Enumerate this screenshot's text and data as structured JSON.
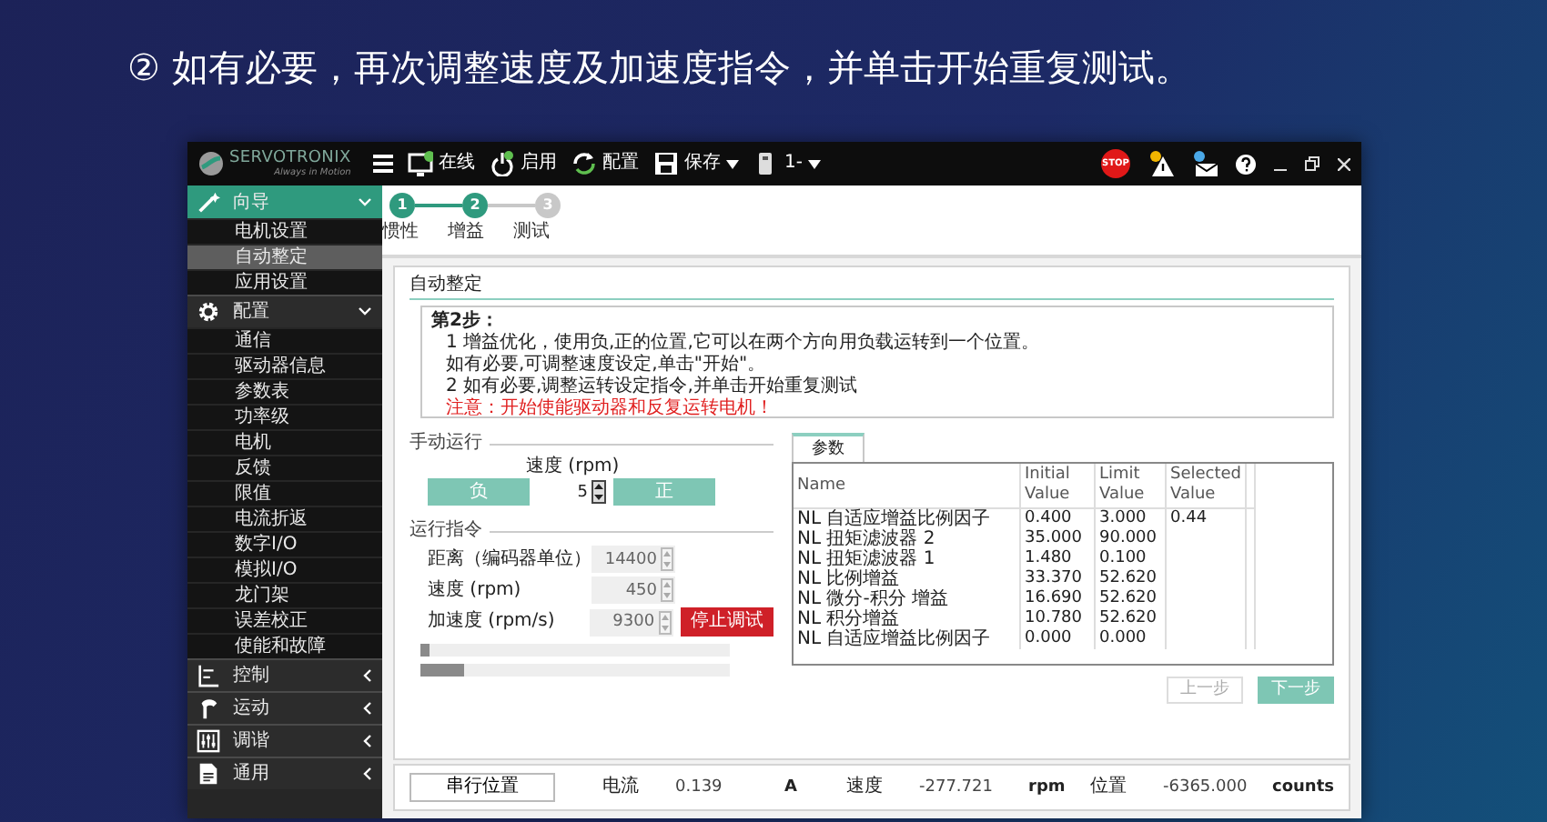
{
  "slide_title": "② 如有必要，再次调整速度及加速度指令，并单击开始重复测试。",
  "app": {
    "logo": {
      "name": "SERVOTRONIX",
      "tagline": "Always in Motion"
    },
    "toolbar": [
      {
        "label": "在线",
        "dropdown": false
      },
      {
        "label": "启用",
        "dropdown": false
      },
      {
        "label": "配置",
        "dropdown": false
      },
      {
        "label": "保存",
        "dropdown": true
      },
      {
        "label": "1-",
        "dropdown": true
      }
    ],
    "stop_label": "STOP",
    "sidebar": [
      {
        "label": "向导",
        "active": true,
        "expanded": true,
        "children": [
          {
            "label": "电机设置",
            "selected": false
          },
          {
            "label": "自动整定",
            "selected": true
          },
          {
            "label": "应用设置",
            "selected": false
          }
        ]
      },
      {
        "label": "配置",
        "active": false,
        "expanded": true,
        "children": [
          {
            "label": "通信",
            "selected": false
          },
          {
            "label": "驱动器信息",
            "selected": false
          },
          {
            "label": "参数表",
            "selected": false
          },
          {
            "label": "功率级",
            "selected": false
          },
          {
            "label": "电机",
            "selected": false
          },
          {
            "label": "反馈",
            "selected": false
          },
          {
            "label": "限值",
            "selected": false
          },
          {
            "label": "电流折返",
            "selected": false
          },
          {
            "label": "数字I/O",
            "selected": false
          },
          {
            "label": "模拟I/O",
            "selected": false
          },
          {
            "label": "龙门架",
            "selected": false
          },
          {
            "label": "误差校正",
            "selected": false
          },
          {
            "label": "使能和故障",
            "selected": false
          }
        ]
      },
      {
        "label": "控制",
        "active": false,
        "expanded": false
      },
      {
        "label": "运动",
        "active": false,
        "expanded": false
      },
      {
        "label": "调谐",
        "active": false,
        "expanded": false
      },
      {
        "label": "通用",
        "active": false,
        "expanded": false
      }
    ],
    "steps": [
      {
        "number": "1",
        "label": "惯性",
        "done": true
      },
      {
        "number": "2",
        "label": "增益",
        "done": true
      },
      {
        "number": "3",
        "label": "测试",
        "done": false
      }
    ],
    "group_title": "自动整定",
    "instructions": [
      {
        "kind": "heading",
        "text": "第2步："
      },
      {
        "kind": "text",
        "text": "1 增益优化，使用负,正的位置,它可以在两个方向用负载运转到一个位置。"
      },
      {
        "kind": "text",
        "text": "如有必要,可调整速度设定,单击\"开始\"。"
      },
      {
        "kind": "text",
        "text": "2 如有必要,调整运转设定指令,并单击开始重复测试"
      },
      {
        "kind": "warning",
        "text": "注意：开始使能驱动器和反复运转电机！"
      }
    ],
    "manual": {
      "title": "手动运行",
      "speed_label": "速度 (rpm)",
      "speed_value": "5",
      "negative_button": "负",
      "positive_button": "正"
    },
    "motion": {
      "title": "运行指令",
      "fields": [
        {
          "label": "距离（编码器单位）",
          "value": "14400",
          "disabled": true
        },
        {
          "label": "速度 (rpm)",
          "value": "450",
          "disabled": true
        },
        {
          "label": "加速度 (rpm/s)",
          "value": "9300",
          "disabled": true
        }
      ],
      "stop_button": "停止调试",
      "progress": [
        {
          "level": 0.03
        },
        {
          "level": 0.14
        }
      ]
    },
    "params": {
      "tab": "参数",
      "columns": [
        "Name",
        "Initial Value",
        "Limit Value",
        "Selected Value"
      ],
      "rows": [
        {
          "name": "NL 自适应增益比例因子",
          "initial": "0.400",
          "limit": "3.000",
          "selected_value": "0.44"
        },
        {
          "name": "NL 扭矩滤波器 2",
          "initial": "35.000",
          "limit": "90.000"
        },
        {
          "name": "NL 扭矩滤波器 1",
          "initial": "1.480",
          "limit": "0.100"
        },
        {
          "name": "NL 比例增益",
          "initial": "33.370",
          "limit": "52.620"
        },
        {
          "name": "NL 微分-积分 增益",
          "initial": "16.690",
          "limit": "52.620"
        },
        {
          "name": "NL 积分增益",
          "initial": "10.780",
          "limit": "52.620"
        },
        {
          "name": "NL 自适应增益比例因子",
          "initial": "0.000",
          "limit": "0.000"
        }
      ]
    },
    "nav": [
      {
        "label": "上一步",
        "disabled": true
      },
      {
        "label": "下一步",
        "disabled": false
      }
    ],
    "status": {
      "button": "串行位置",
      "readings": [
        {
          "label": "电流",
          "value": "0.139",
          "unit": "A"
        },
        {
          "label": "速度",
          "value": "-277.721",
          "unit": "rpm"
        },
        {
          "label": "位置",
          "value": "-6365.000",
          "unit": "counts"
        }
      ]
    }
  }
}
